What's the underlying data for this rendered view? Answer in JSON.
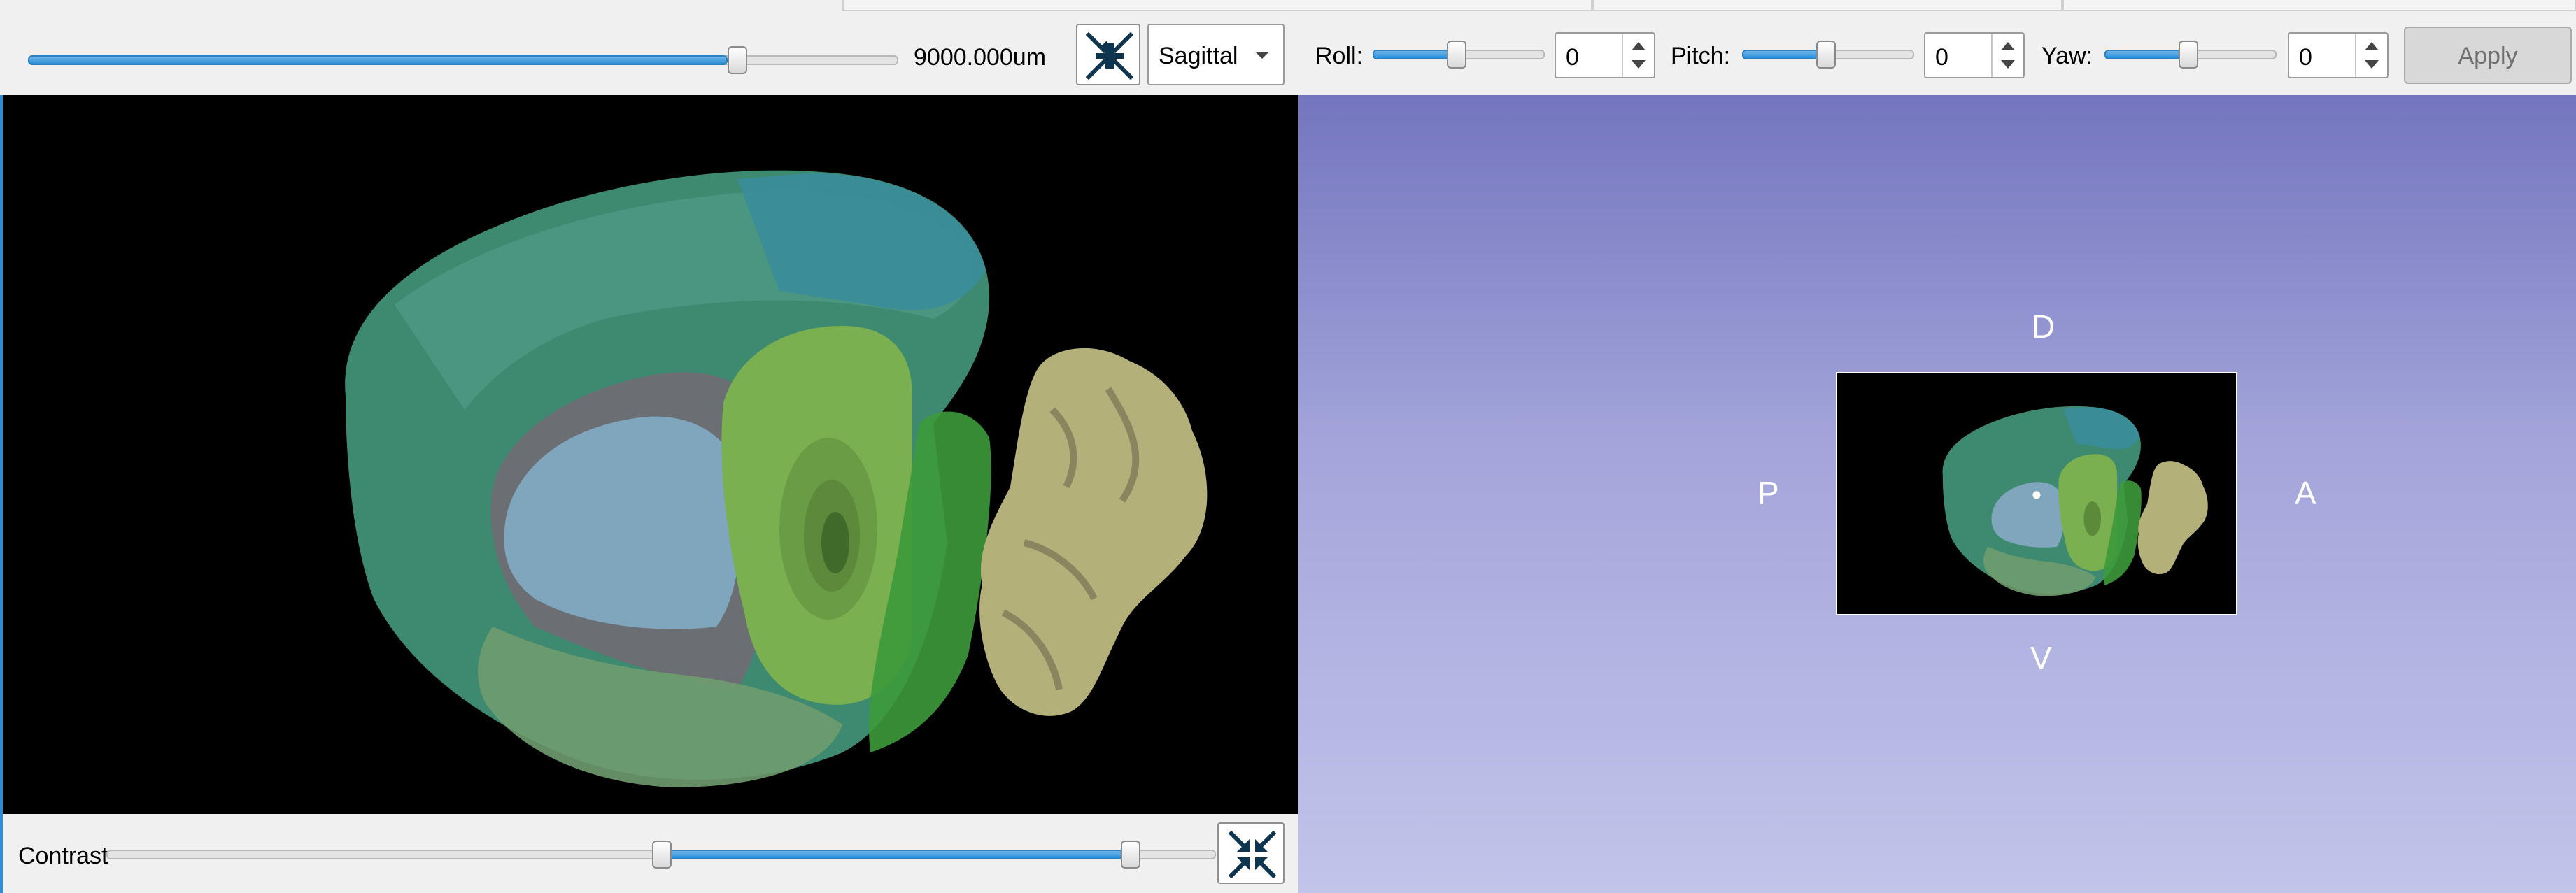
{
  "toolbar": {
    "zoom_value_label": "9000.000um",
    "zoom_slider_fraction": 0.82,
    "fit_view_icon": "fit-to-view-icon",
    "view_select": {
      "selected": "Sagittal"
    },
    "roll": {
      "label": "Roll:",
      "value": "0",
      "slider_fraction": 0.5
    },
    "pitch": {
      "label": "Pitch:",
      "value": "0",
      "slider_fraction": 0.5
    },
    "yaw": {
      "label": "Yaw:",
      "value": "0",
      "slider_fraction": 0.5
    },
    "apply_label": "Apply"
  },
  "bottom_bar": {
    "contrast_label": "Contrast",
    "contrast_range_fraction": [
      0.5,
      0.93
    ],
    "fit_view_icon": "fit-to-view-icon"
  },
  "viewer_3d": {
    "orientation": {
      "dorsal": "D",
      "ventral": "V",
      "posterior": "P",
      "anterior": "A"
    }
  },
  "colors": {
    "accent": "#2c8fd6",
    "viewer_bg_top": "#7475bf",
    "viewer_bg_bottom": "#c2c4ea",
    "cortex": "#3e8a70",
    "hippocampus_olfactory": "#7ab04f",
    "striatum": "#7fa6bd",
    "cerebellum": "#b4b07a"
  }
}
